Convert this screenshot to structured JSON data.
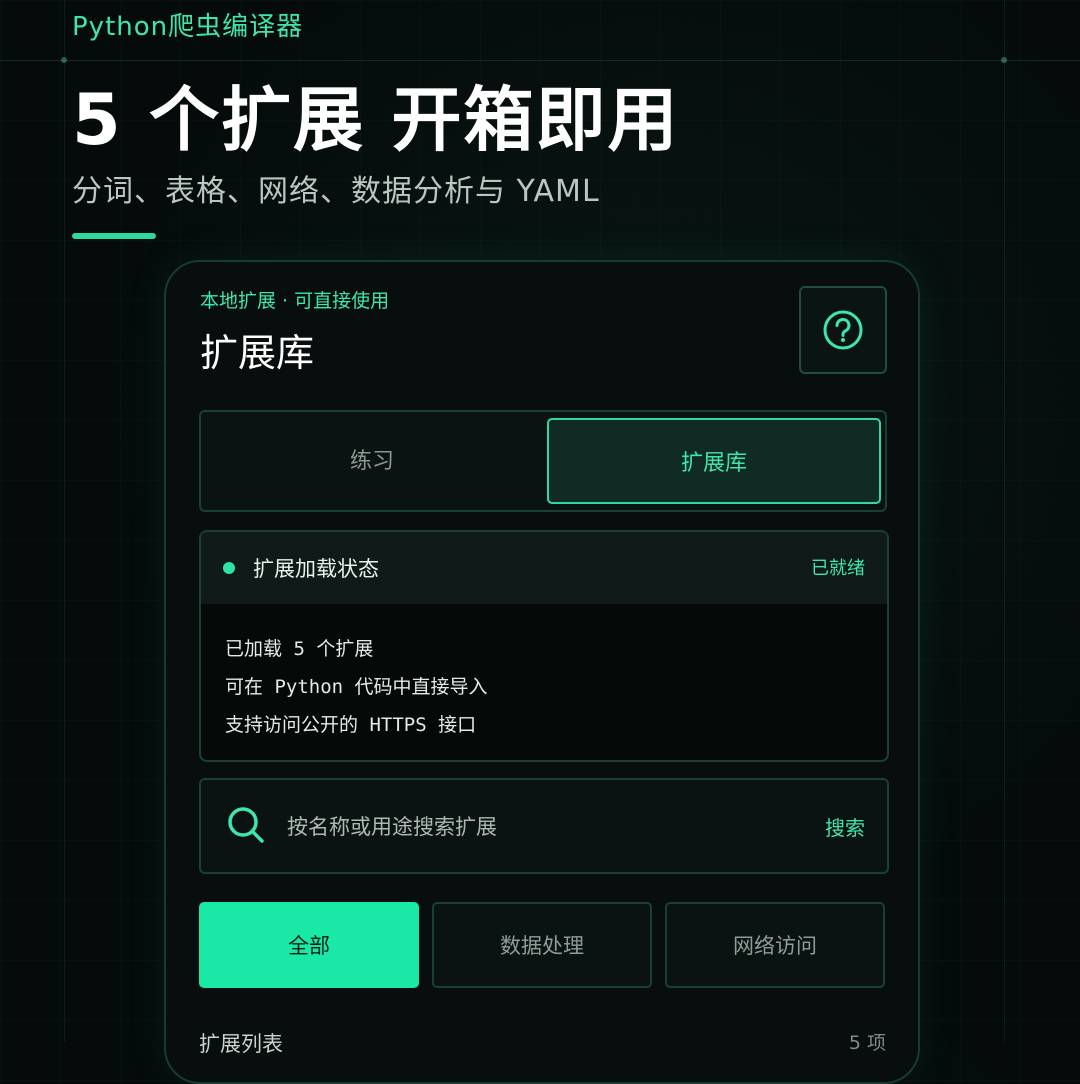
{
  "brand": "Python爬虫编译器",
  "hero": {
    "title": "5 个扩展 开箱即用",
    "subtitle": "分词、表格、网络、数据分析与 YAML"
  },
  "panel": {
    "eyebrow": "本地扩展 · 可直接使用",
    "title": "扩展库",
    "help_icon": "question-circle-icon"
  },
  "tabs": [
    {
      "label": "练习",
      "active": false
    },
    {
      "label": "扩展库",
      "active": true
    }
  ],
  "status": {
    "title": "扩展加载状态",
    "state": "已就绪",
    "lines": [
      "已加载 5 个扩展",
      "可在 Python 代码中直接导入",
      "支持访问公开的 HTTPS 接口"
    ]
  },
  "search": {
    "placeholder": "按名称或用途搜索扩展",
    "button": "搜索",
    "icon": "search-icon"
  },
  "filters": [
    {
      "label": "全部",
      "active": true
    },
    {
      "label": "数据处理",
      "active": false
    },
    {
      "label": "网络访问",
      "active": false
    }
  ],
  "list": {
    "label": "扩展列表",
    "count": "5 项"
  },
  "colors": {
    "accent": "#3ee6ad",
    "accent_fill": "#19e8a6",
    "background": "#050b0b"
  }
}
